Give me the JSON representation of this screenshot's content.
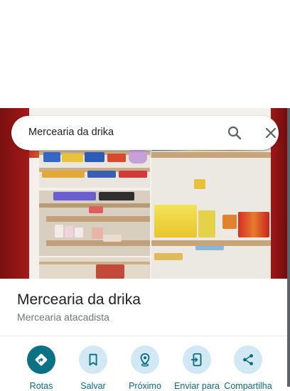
{
  "search": {
    "value": "Mercearia da drika"
  },
  "place": {
    "name": "Mercearia da drika",
    "category": "Mercearia atacadista"
  },
  "actions": [
    {
      "label": "Rotas",
      "icon": "directions-icon"
    },
    {
      "label": "Salvar",
      "icon": "bookmark-icon"
    },
    {
      "label": "Próximo",
      "icon": "nearby-icon"
    },
    {
      "label": "Enviar para",
      "icon": "send-to-phone-icon"
    },
    {
      "label": "Compartilha",
      "icon": "share-icon"
    }
  ],
  "colors": {
    "accent": "#0b7285",
    "action_bg": "#d2e9f5",
    "photo_border": "#8e1414"
  }
}
